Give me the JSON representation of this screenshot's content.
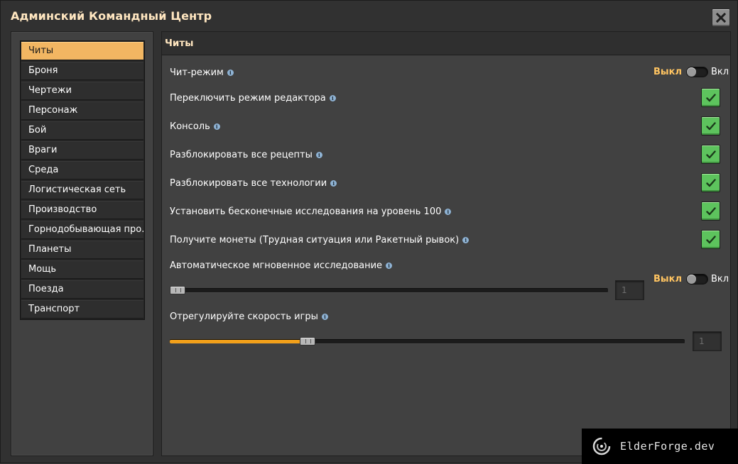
{
  "window": {
    "title": "Админский Командный Центр"
  },
  "sidebar": {
    "items": [
      {
        "label": "Читы",
        "active": true
      },
      {
        "label": "Броня"
      },
      {
        "label": "Чертежи"
      },
      {
        "label": "Персонаж"
      },
      {
        "label": "Бой"
      },
      {
        "label": "Враги"
      },
      {
        "label": "Среда"
      },
      {
        "label": "Логистическая сеть"
      },
      {
        "label": "Производство"
      },
      {
        "label": "Горнодобывающая про..."
      },
      {
        "label": "Планеты"
      },
      {
        "label": "Мощь"
      },
      {
        "label": "Поезда"
      },
      {
        "label": "Транспорт"
      }
    ]
  },
  "content": {
    "title": "Читы",
    "cheat_mode": {
      "label": "Чит-режим",
      "off_label": "Выкл",
      "on_label": "Вкл",
      "enabled": false
    },
    "checkbox_settings": [
      {
        "label": "Переключить режим редактора",
        "checked": true
      },
      {
        "label": "Консоль",
        "checked": true
      },
      {
        "label": "Разблокировать все рецепты",
        "checked": true
      },
      {
        "label": "Разблокировать все технологии",
        "checked": true
      },
      {
        "label": "Установить бесконечные исследования на уровень 100",
        "checked": true
      },
      {
        "label": "Получите монеты (Трудная ситуация или Ракетный рывок)",
        "checked": true
      }
    ],
    "auto_research": {
      "label": "Автоматическое мгновенное исследование",
      "off_label": "Выкл",
      "on_label": "Вкл",
      "enabled": false,
      "slider_fraction": 0.0,
      "value": "1"
    },
    "game_speed": {
      "label": "Отрегулируйте скорость игры",
      "slider_fraction": 0.26,
      "value": "1"
    }
  },
  "watermark": {
    "text": "ElderForge.dev"
  },
  "icons": {
    "close": "close-icon",
    "info": "info-icon",
    "check": "checkmark-icon",
    "logo": "elderforge-logo-icon"
  },
  "colors": {
    "accent": "#f2b662",
    "title": "#ffe6c0",
    "switch_off": "#ffc461",
    "check_green": "#5dc35d",
    "slider_fill": "#f2a01a"
  }
}
